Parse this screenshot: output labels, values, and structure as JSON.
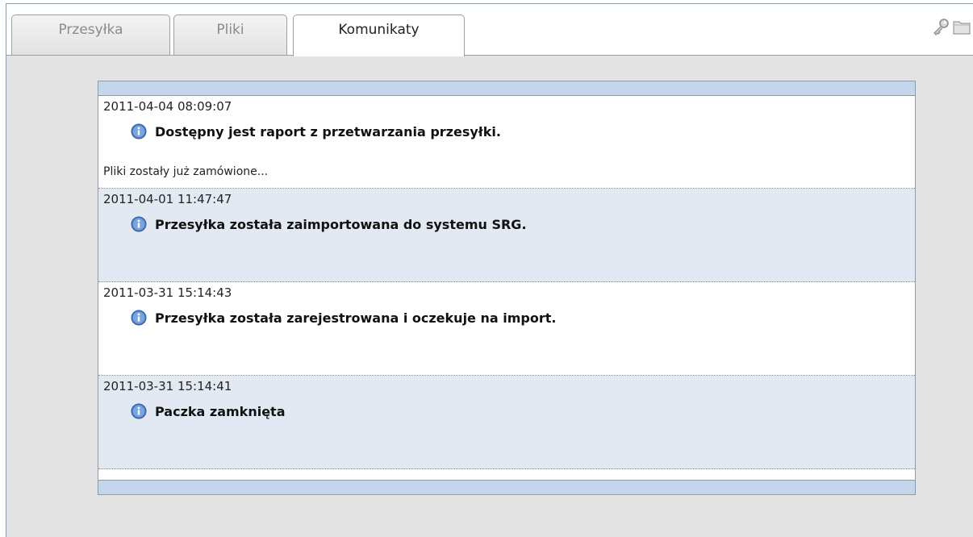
{
  "tabs": [
    {
      "label": "Przesyłka",
      "active": false
    },
    {
      "label": "Pliki",
      "active": false
    },
    {
      "label": "Komunikaty",
      "active": true
    }
  ],
  "toolbar": {
    "icons": [
      "key-icon",
      "folder-icon"
    ]
  },
  "messages": [
    {
      "timestamp": "2011-04-04 08:09:07",
      "text": "Dostępny jest raport z przetwarzania przesyłki.",
      "note": "Pliki zostały już zamówione...",
      "icon": "info-icon"
    },
    {
      "timestamp": "2011-04-01 11:47:47",
      "text": "Przesyłka została zaimportowana do systemu SRG.",
      "note": "",
      "icon": "info-icon"
    },
    {
      "timestamp": "2011-03-31 15:14:43",
      "text": "Przesyłka została zarejestrowana i oczekuje na import.",
      "note": "",
      "icon": "info-icon"
    },
    {
      "timestamp": "2011-03-31 15:14:41",
      "text": "Paczka zamknięta",
      "note": "",
      "icon": "info-icon"
    }
  ],
  "colors": {
    "header_bar": "#c4d6ec",
    "alt_row": "#e3e9f3",
    "panel_bg": "#e4e4e4",
    "info_icon": "#4a7fc9"
  }
}
